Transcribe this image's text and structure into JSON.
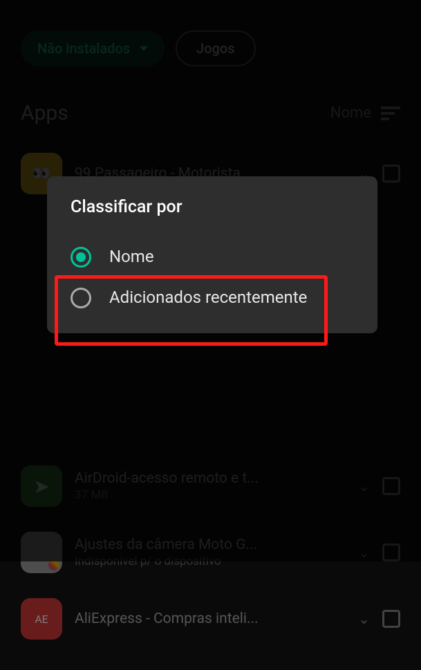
{
  "filters": {
    "installed_label": "Não instalados",
    "games_label": "Jogos"
  },
  "section": {
    "title": "Apps",
    "sort_label": "Nome"
  },
  "apps": [
    {
      "title": "99 Passageiro - Motorista...",
      "sub": ""
    },
    {
      "title": "AirDroid-acesso remoto e t...",
      "sub": "37 MB"
    },
    {
      "title": "Ajustes da câmera Moto G...",
      "sub": "Indisponível p/ o dispositivo"
    },
    {
      "title": "AliExpress - Compras inteli...",
      "sub": ""
    }
  ],
  "dialog": {
    "title": "Classificar por",
    "options": {
      "name": "Nome",
      "recent": "Adicionados recentemente"
    }
  }
}
